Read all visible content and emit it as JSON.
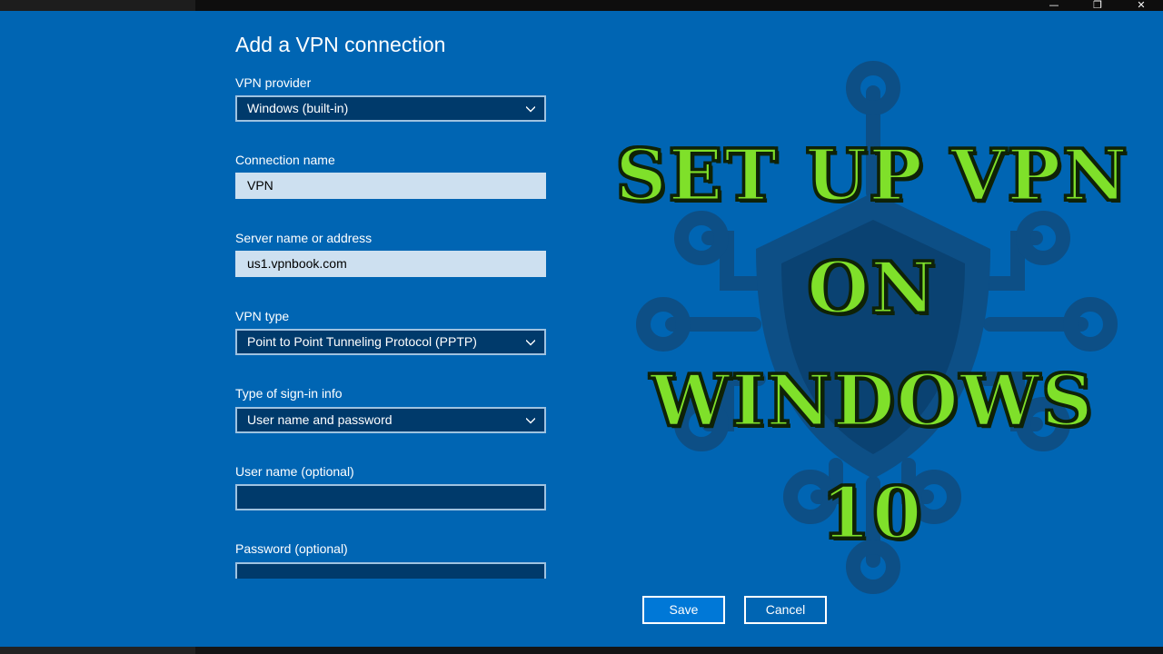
{
  "window": {
    "controls": {
      "minimize": "—",
      "restore": "❐",
      "close": "✕"
    }
  },
  "form": {
    "title": "Add a VPN connection",
    "fields": [
      {
        "label": "VPN provider",
        "value": "Windows (built-in)",
        "kind": "dropdown"
      },
      {
        "label": "Connection name",
        "value": "VPN",
        "kind": "text-filled"
      },
      {
        "label": "Server name or address",
        "value": "us1.vpnbook.com",
        "kind": "text-filled"
      },
      {
        "label": "VPN type",
        "value": "Point to Point Tunneling Protocol (PPTP)",
        "kind": "dropdown"
      },
      {
        "label": "Type of sign-in info",
        "value": "User name and password",
        "kind": "dropdown"
      },
      {
        "label": "User name (optional)",
        "value": "",
        "kind": "text-empty"
      },
      {
        "label": "Password (optional)",
        "value": "",
        "kind": "text-empty"
      }
    ],
    "buttons": {
      "save": "Save",
      "cancel": "Cancel"
    }
  },
  "overlay": {
    "lines": [
      "SET UP VPN",
      "ON",
      "WINDOWS",
      "10"
    ]
  },
  "colors": {
    "panel_bg": "#0065b3",
    "field_dark": "#003a6b",
    "field_light": "#cde0f0",
    "overlay_text": "#7fe02a",
    "art": "#0d4f86"
  }
}
